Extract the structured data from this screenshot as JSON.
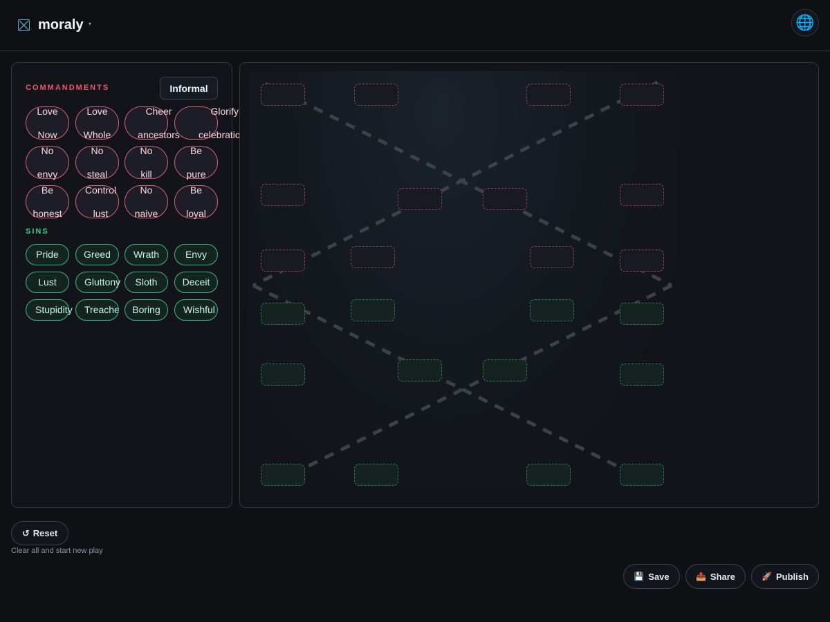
{
  "header": {
    "brand": "moraly",
    "brand_caret": "▾",
    "globe_glyph": "🌐"
  },
  "left_panel": {
    "commandments_title": "COMMANDMENTS",
    "mode_label": "Informal",
    "commandments": [
      {
        "line1": "Love",
        "line2": "Now"
      },
      {
        "line1": "Love",
        "line2": "Whole"
      },
      {
        "line1": "Cheer",
        "line2": "ancestors"
      },
      {
        "line1": "Glorify",
        "line2": "celebrations"
      },
      {
        "line1": "No",
        "line2": "envy"
      },
      {
        "line1": "No",
        "line2": "steal"
      },
      {
        "line1": "No",
        "line2": "kill"
      },
      {
        "line1": "Be",
        "line2": "pure"
      },
      {
        "line1": "Be",
        "line2": "honest"
      },
      {
        "line1": "Control",
        "line2": "lust"
      },
      {
        "line1": "No",
        "line2": "naive"
      },
      {
        "line1": "Be",
        "line2": "loyal"
      }
    ],
    "sins_title": "SINS",
    "sins": [
      "Pride",
      "Greed",
      "Wrath",
      "Envy",
      "Lust",
      "Gluttony",
      "Sloth",
      "Deceit",
      "Stupidity",
      "Treachery",
      "Boring",
      "Wishful"
    ]
  },
  "footer": {
    "reset_icon": "↺",
    "reset_label": "Reset",
    "reset_hint": "Clear all and start new play",
    "save_icon": "💾",
    "save_label": "Save",
    "share_icon": "📤",
    "share_label": "Share",
    "publish_icon": "🚀",
    "publish_label": "Publish"
  },
  "colors": {
    "commandment_accent": "#f0566f",
    "sin_accent": "#3ecf8e",
    "background": "#0f1115"
  }
}
